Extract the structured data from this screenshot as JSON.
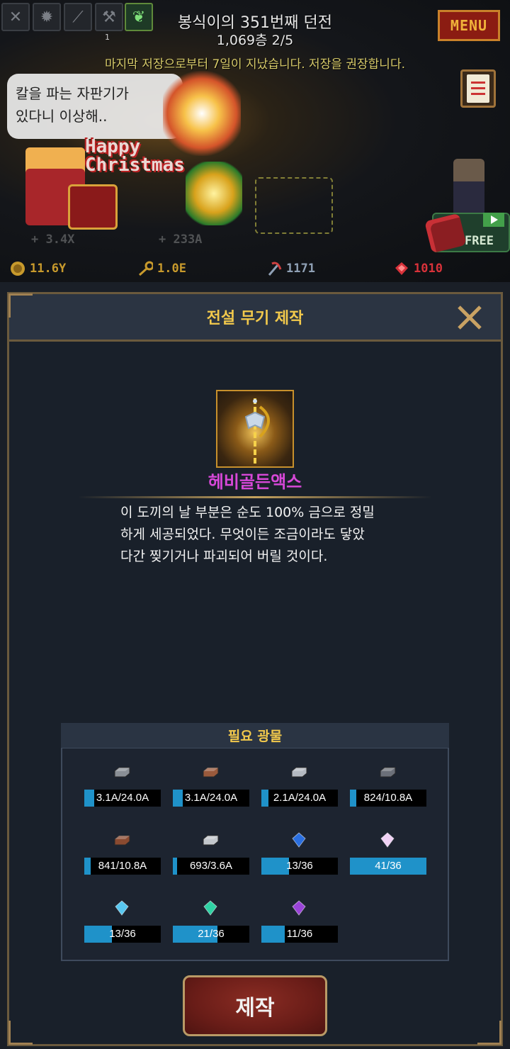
{
  "hud": {
    "dungeon_title": "봉식이의 351번째 던전",
    "floor_info": "1,069층 2/5",
    "save_warning": "마지막 저장으로부터 7일이 지났습니다. 저장을 권장합니다.",
    "menu_label": "MENU",
    "skill_slot_number": "1",
    "speech_bubble": "칼을 파는 자판기가\n있다니 이상해..",
    "christmas_line1": "Happy",
    "christmas_line2": "Christmas",
    "stat_left": "+ 3.4X",
    "stat_right": "+ 233A",
    "free_label": "FREE",
    "currencies": {
      "gold": "11.6Y",
      "key": "1.0E",
      "pickaxe": "1171",
      "ruby": "1010"
    },
    "colors": {
      "gold": "#c89a2c",
      "key": "#c89a2c",
      "pickaxe": "#8fa0b5",
      "ruby": "#d8323a"
    }
  },
  "panel": {
    "title": "전설 무기 제작",
    "item_name": "헤비골든액스",
    "item_desc_lines": [
      "이 도끼의 날 부분은 순도 100% 금으로 정밀",
      "하게 세공되었다. 무엇이든 조금이라도 닿았",
      "다간 찢기거나 파괴되어 버릴 것이다."
    ],
    "requirements_title": "필요 광물",
    "ores": [
      {
        "icon": "iron-ore-icon",
        "color": "#8a8f96",
        "text": "3.1A/24.0A",
        "fill": 0.13
      },
      {
        "icon": "copper-ore-icon",
        "color": "#9a5a3c",
        "text": "3.1A/24.0A",
        "fill": 0.13
      },
      {
        "icon": "silver-ore-icon",
        "color": "#b5bac2",
        "text": "2.1A/24.0A",
        "fill": 0.09
      },
      {
        "icon": "steel-bar-icon",
        "color": "#6c7079",
        "text": "824/10.8A",
        "fill": 0.08
      },
      {
        "icon": "bronze-bar-icon",
        "color": "#8a4a30",
        "text": "841/10.8A",
        "fill": 0.08
      },
      {
        "icon": "platinum-bar-icon",
        "color": "#c3c7cc",
        "text": "693/3.6A",
        "fill": 0.06
      },
      {
        "icon": "sapphire-icon",
        "color": "#2a6fe0",
        "text": "13/36",
        "fill": 0.36
      },
      {
        "icon": "pearl-icon",
        "color": "#f0d2f5",
        "text": "41/36",
        "fill": 1.0
      },
      {
        "icon": "aquamarine-icon",
        "color": "#58c7f0",
        "text": "13/36",
        "fill": 0.36
      },
      {
        "icon": "emerald-icon",
        "color": "#2fd2a4",
        "text": "21/36",
        "fill": 0.58
      },
      {
        "icon": "amethyst-icon",
        "color": "#9a44d8",
        "text": "11/36",
        "fill": 0.31
      }
    ],
    "craft_label": "제작"
  }
}
